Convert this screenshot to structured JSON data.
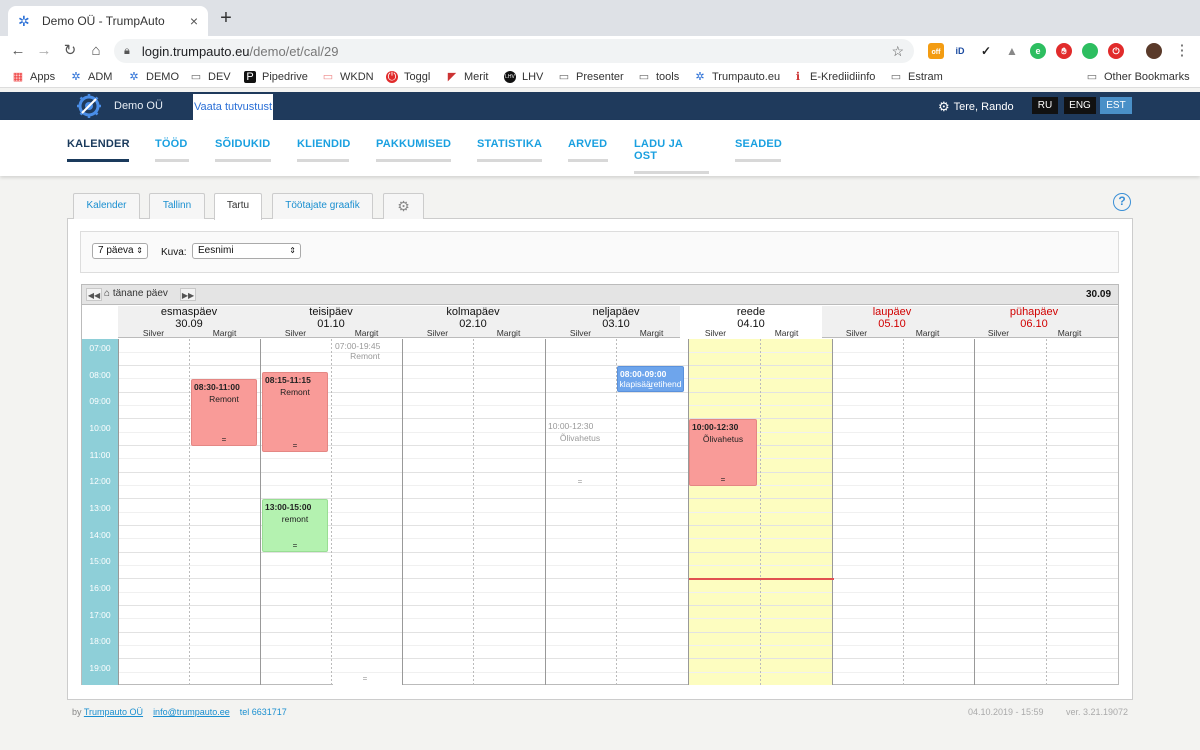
{
  "browser": {
    "tab_title": "Demo OÜ - TrumpAuto",
    "url_host": "login.trumpauto.eu",
    "url_path": "/demo/et/cal/29",
    "bookmarks": [
      "Apps",
      "ADM",
      "DEMO",
      "DEV",
      "Pipedrive",
      "WKDN",
      "Toggl",
      "Merit",
      "LHV",
      "Presenter",
      "tools",
      "Trumpauto.eu",
      "E-Krediidiinfo",
      "Estram"
    ],
    "other_bookmarks": "Other Bookmarks",
    "ext_badge": "off"
  },
  "header": {
    "company": "Demo OÜ",
    "tour_label": "Vaata tutvustust",
    "greeting": "Tere, Rando",
    "languages": [
      "RU",
      "ENG",
      "EST"
    ],
    "active_language": "EST"
  },
  "nav": {
    "items": [
      "KALENDER",
      "TÖÖD",
      "SÕIDUKID",
      "KLIENDID",
      "PAKKUMISED",
      "STATISTIKA",
      "ARVED",
      "LADU JA OST",
      "SEADED"
    ],
    "active": "KALENDER"
  },
  "subtabs": [
    "Kalender",
    "Tallinn",
    "Tartu",
    "Töötajate graafik"
  ],
  "active_subtab": "Tartu",
  "filters": {
    "range_value": "7 päeva",
    "view_label": "Kuva:",
    "view_value": "Eesnimi"
  },
  "calendar": {
    "today_label": "tänane päev",
    "current_date": "30.09",
    "days": [
      {
        "name": "esmaspäev",
        "date": "30.09",
        "weekend": false,
        "today": false
      },
      {
        "name": "teisipäev",
        "date": "01.10",
        "weekend": false,
        "today": false
      },
      {
        "name": "kolmapäev",
        "date": "02.10",
        "weekend": false,
        "today": false
      },
      {
        "name": "neljapäev",
        "date": "03.10",
        "weekend": false,
        "today": false
      },
      {
        "name": "reede",
        "date": "04.10",
        "weekend": false,
        "today": true
      },
      {
        "name": "laupäev",
        "date": "05.10",
        "weekend": true,
        "today": false
      },
      {
        "name": "pühapäev",
        "date": "06.10",
        "weekend": true,
        "today": false
      }
    ],
    "staff": [
      "Silver",
      "Margit"
    ],
    "hours": [
      "07:00",
      "08:00",
      "09:00",
      "10:00",
      "11:00",
      "12:00",
      "13:00",
      "14:00",
      "15:00",
      "16:00",
      "17:00",
      "18:00",
      "19:00"
    ],
    "events": [
      {
        "time": "08:30-11:00",
        "title": "Remont",
        "color": "red"
      },
      {
        "time": "08:15-11:15",
        "title": "Remont",
        "color": "red"
      },
      {
        "time": "13:00-15:00",
        "title": "remont",
        "color": "green"
      },
      {
        "time": "07:00-19:45",
        "title": "Remont",
        "color": "ghost"
      },
      {
        "time": "08:00-09:00",
        "title": "klapisääretihend",
        "color": "blue"
      },
      {
        "time": "10:00-12:30",
        "title": "Õlivahetus",
        "color": "ghost"
      },
      {
        "time": "10:00-12:30",
        "title": "Õlivahetus",
        "color": "red"
      }
    ],
    "event_marker": "="
  },
  "footer": {
    "by": "by",
    "company_link": "Trumpauto OÜ",
    "email": "info@trumpauto.ee",
    "phone": "tel 6631717",
    "timestamp": "04.10.2019 - 15:59",
    "version": "ver. 3.21.19072"
  },
  "colors": {
    "header_bg": "#1f3a5c",
    "nav_accent": "#1aa0e0",
    "time_column": "#8ecfd8",
    "today_column": "#fdfdc0",
    "event_red": "#f99b98",
    "event_green": "#b4f2b0",
    "event_blue": "#6ea5ec",
    "now_line": "#e05050"
  }
}
